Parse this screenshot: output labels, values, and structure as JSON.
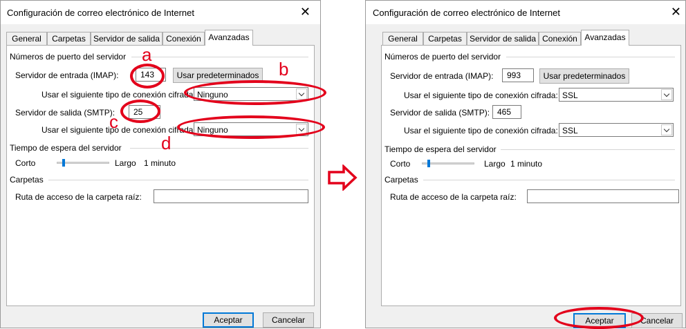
{
  "dialog_before": {
    "title": "Configuración de correo electrónico de Internet",
    "close_label": "✕",
    "tabs": [
      "General",
      "Carpetas",
      "Servidor de salida",
      "Conexión",
      "Avanzadas"
    ],
    "group_ports": "Números de puerto del servidor",
    "incoming_label": "Servidor de entrada (IMAP):",
    "incoming_value": "143",
    "defaults_button": "Usar predeterminados",
    "encryption_label_in": "Usar el siguiente tipo de conexión cifrada:",
    "encryption_in_value": "Ninguno",
    "outgoing_label": "Servidor de salida (SMTP):",
    "outgoing_value": "25",
    "encryption_label_out": "Usar el siguiente tipo de conexión cifrada:",
    "encryption_out_value": "Ninguno",
    "group_timeout": "Tiempo de espera del servidor",
    "timeout_short": "Corto",
    "timeout_long": "Largo",
    "timeout_value": "1 minuto",
    "group_folders": "Carpetas",
    "root_path_label": "Ruta de acceso de la carpeta raíz:",
    "root_path_value": "",
    "ok_button": "Aceptar",
    "cancel_button": "Cancelar"
  },
  "dialog_after": {
    "title": "Configuración de correo electrónico de Internet",
    "close_label": "✕",
    "tabs": [
      "General",
      "Carpetas",
      "Servidor de salida",
      "Conexión",
      "Avanzadas"
    ],
    "group_ports": "Números de puerto del servidor",
    "incoming_label": "Servidor de entrada (IMAP):",
    "incoming_value": "993",
    "defaults_button": "Usar predeterminados",
    "encryption_label_in": "Usar el siguiente tipo de conexión cifrada:",
    "encryption_in_value": "SSL",
    "outgoing_label": "Servidor de salida (SMTP):",
    "outgoing_value": "465",
    "encryption_label_out": "Usar el siguiente tipo de conexión cifrada:",
    "encryption_out_value": "SSL",
    "group_timeout": "Tiempo de espera del servidor",
    "timeout_short": "Corto",
    "timeout_long": "Largo",
    "timeout_value": "1 minuto",
    "group_folders": "Carpetas",
    "root_path_label": "Ruta de acceso de la carpeta raíz:",
    "root_path_value": "",
    "ok_button": "Aceptar",
    "cancel_button": "Cancelar"
  },
  "annotations": {
    "letters": [
      "a",
      "b",
      "c",
      "d"
    ],
    "color": "#e3001b",
    "arrow_icon": "right-arrow-icon"
  },
  "colors": {
    "accent": "#0078d7",
    "annotation": "#e3001b"
  }
}
